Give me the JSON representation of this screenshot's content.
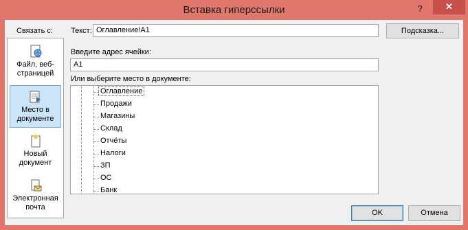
{
  "window": {
    "title": "Вставка гиперссылки",
    "help": "?",
    "close": "✕"
  },
  "link_to": {
    "label": "Связать с:",
    "items": [
      {
        "label_line1": "Файл, веб-",
        "label_line2": "страницей",
        "icon": "web-page-icon"
      },
      {
        "label_line1": "Место в",
        "label_line2": "документе",
        "icon": "place-in-document-icon",
        "active": true
      },
      {
        "label_line1": "Новый",
        "label_line2": "документ",
        "icon": "new-document-icon"
      },
      {
        "label_line1": "Электронная",
        "label_line2": "почта",
        "icon": "email-icon"
      }
    ]
  },
  "text_to_display": {
    "label": "Текст:",
    "value": "Оглавление!A1"
  },
  "screentip_button": "Подсказка...",
  "cell_reference": {
    "label": "Введите адрес ячейки:",
    "value": "A1"
  },
  "document_place": {
    "label": "Или выберите место в документе:",
    "items": [
      "Оглавление",
      "Продажи",
      "Магазины",
      "Склад",
      "Отчёты",
      "Налоги",
      "ЗП",
      "ОС",
      "Банк"
    ],
    "selected": "Оглавление"
  },
  "buttons": {
    "ok": "OK",
    "cancel": "Отмена"
  }
}
